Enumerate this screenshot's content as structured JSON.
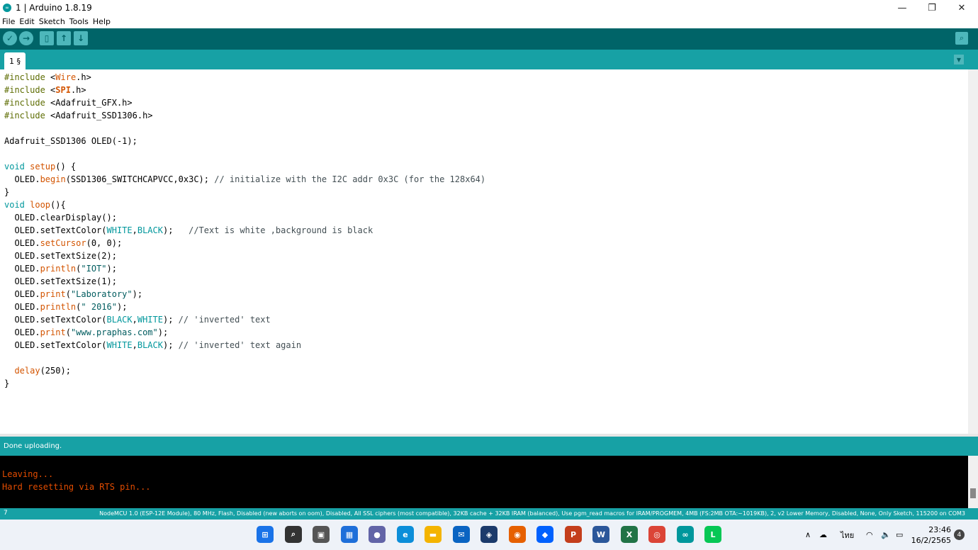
{
  "window": {
    "title": "1 | Arduino 1.8.19",
    "minimize": "—",
    "maximize": "❐",
    "close": "✕"
  },
  "menu": [
    "File",
    "Edit",
    "Sketch",
    "Tools",
    "Help"
  ],
  "toolbar": {
    "verify": "✓",
    "upload": "→",
    "new": "▯",
    "open": "↑",
    "save": "↓",
    "serial_monitor": "⌕"
  },
  "tab": {
    "label": "1 §",
    "menu": "▼"
  },
  "code_lines": [
    [
      [
        "#include ",
        "kw"
      ],
      [
        "<",
        ""
      ],
      [
        "Wire",
        "fn"
      ],
      [
        ".h>",
        ""
      ]
    ],
    [
      [
        "#include ",
        "kw"
      ],
      [
        "<",
        ""
      ],
      [
        "SPI",
        "fn bold"
      ],
      [
        ".h>",
        ""
      ]
    ],
    [
      [
        "#include ",
        "kw"
      ],
      [
        "<Adafruit_GFX.h>",
        ""
      ]
    ],
    [
      [
        "#include ",
        "kw"
      ],
      [
        "<Adafruit_SSD1306.h>",
        ""
      ]
    ],
    [],
    [
      [
        "Adafruit_SSD1306 OLED(-1);",
        ""
      ]
    ],
    [],
    [
      [
        "void ",
        "ty"
      ],
      [
        "setup",
        "fn"
      ],
      [
        "() {",
        ""
      ]
    ],
    [
      [
        "  OLED.",
        ""
      ],
      [
        "begin",
        "fn"
      ],
      [
        "(SSD1306_SWITCHCAPVCC,0x3C); ",
        ""
      ],
      [
        "// initialize with the I2C addr 0x3C (for the 128x64)",
        "cm"
      ]
    ],
    [
      [
        "}",
        ""
      ]
    ],
    [
      [
        "void ",
        "ty"
      ],
      [
        "loop",
        "fn"
      ],
      [
        "(){",
        ""
      ]
    ],
    [
      [
        "  OLED.clearDisplay();",
        ""
      ]
    ],
    [
      [
        "  OLED.setTextColor(",
        ""
      ],
      [
        "WHITE",
        "ty"
      ],
      [
        ",",
        ""
      ],
      [
        "BLACK",
        "ty"
      ],
      [
        ");   ",
        ""
      ],
      [
        "//Text is white ,background is black",
        "cm"
      ]
    ],
    [
      [
        "  OLED.",
        ""
      ],
      [
        "setCursor",
        "fn"
      ],
      [
        "(0, 0);",
        ""
      ]
    ],
    [
      [
        "  OLED.setTextSize(2);",
        ""
      ]
    ],
    [
      [
        "  OLED.",
        ""
      ],
      [
        "println",
        "fn"
      ],
      [
        "(",
        ""
      ],
      [
        "\"IOT\"",
        "st"
      ],
      [
        ");",
        ""
      ]
    ],
    [
      [
        "  OLED.setTextSize(1);",
        ""
      ]
    ],
    [
      [
        "  OLED.",
        ""
      ],
      [
        "print",
        "fn"
      ],
      [
        "(",
        ""
      ],
      [
        "\"Laboratory\"",
        "st"
      ],
      [
        ");",
        ""
      ]
    ],
    [
      [
        "  OLED.",
        ""
      ],
      [
        "println",
        "fn"
      ],
      [
        "(",
        ""
      ],
      [
        "\" 2016\"",
        "st"
      ],
      [
        ");",
        ""
      ]
    ],
    [
      [
        "  OLED.setTextColor(",
        ""
      ],
      [
        "BLACK",
        "ty"
      ],
      [
        ",",
        ""
      ],
      [
        "WHITE",
        "ty"
      ],
      [
        "); ",
        ""
      ],
      [
        "// 'inverted' text",
        "cm"
      ]
    ],
    [
      [
        "  OLED.",
        ""
      ],
      [
        "print",
        "fn"
      ],
      [
        "(",
        ""
      ],
      [
        "\"www.praphas.com\"",
        "st"
      ],
      [
        ");",
        ""
      ]
    ],
    [
      [
        "  OLED.setTextColor(",
        ""
      ],
      [
        "WHITE",
        "ty"
      ],
      [
        ",",
        ""
      ],
      [
        "BLACK",
        "ty"
      ],
      [
        "); ",
        ""
      ],
      [
        "// 'inverted' text again",
        "cm"
      ]
    ],
    [],
    [
      [
        "  ",
        ""
      ],
      [
        "delay",
        "fn"
      ],
      [
        "(250);",
        ""
      ]
    ],
    [
      [
        "}",
        ""
      ]
    ]
  ],
  "status": {
    "message": "Done uploading."
  },
  "console_lines": [
    "",
    "Leaving...",
    "Hard resetting via RTS pin..."
  ],
  "footer": {
    "line_number": "7",
    "board": "NodeMCU 1.0 (ESP-12E Module), 80 MHz, Flash, Disabled (new aborts on oom), Disabled, All SSL ciphers (most compatible), 32KB cache + 32KB IRAM (balanced), Use pgm_read macros for IRAM/PROGMEM, 4MB (FS:2MB OTA:~1019KB), 2, v2 Lower Memory, Disabled, None, Only Sketch, 115200 on COM3"
  },
  "taskbar": {
    "apps": [
      {
        "name": "start-icon",
        "glyph": "⊞",
        "color": "#1a73e8"
      },
      {
        "name": "search-icon",
        "glyph": "⌕",
        "color": "#333333"
      },
      {
        "name": "task-view-icon",
        "glyph": "▣",
        "color": "#555555"
      },
      {
        "name": "widgets-icon",
        "glyph": "▦",
        "color": "#1e6fd9"
      },
      {
        "name": "teams-chat-icon",
        "glyph": "●",
        "color": "#6264a7"
      },
      {
        "name": "edge-icon",
        "glyph": "e",
        "color": "#0c8ed9"
      },
      {
        "name": "file-explorer-icon",
        "glyph": "▬",
        "color": "#f4b400"
      },
      {
        "name": "mail-icon",
        "glyph": "✉",
        "color": "#0a64c2"
      },
      {
        "name": "shield-app-icon",
        "glyph": "◈",
        "color": "#1b3a6b"
      },
      {
        "name": "firefox-icon",
        "glyph": "◉",
        "color": "#e66000"
      },
      {
        "name": "dropbox-icon",
        "glyph": "◆",
        "color": "#0061fe"
      },
      {
        "name": "powerpoint-icon",
        "glyph": "P",
        "color": "#c43e1c"
      },
      {
        "name": "word-icon",
        "glyph": "W",
        "color": "#2b579a"
      },
      {
        "name": "excel-icon",
        "glyph": "X",
        "color": "#217346"
      },
      {
        "name": "chrome-icon",
        "glyph": "◎",
        "color": "#db4437"
      },
      {
        "name": "arduino-icon",
        "glyph": "∞",
        "color": "#00979c"
      },
      {
        "name": "line-icon",
        "glyph": "L",
        "color": "#06c755"
      }
    ],
    "tray": {
      "chevron": "∧",
      "cloud": "☁",
      "language": "ไทย",
      "wifi": "◠",
      "volume": "🔈",
      "battery": "▭"
    },
    "time": "23:46",
    "date": "16/2/2565",
    "notifications": "4"
  }
}
